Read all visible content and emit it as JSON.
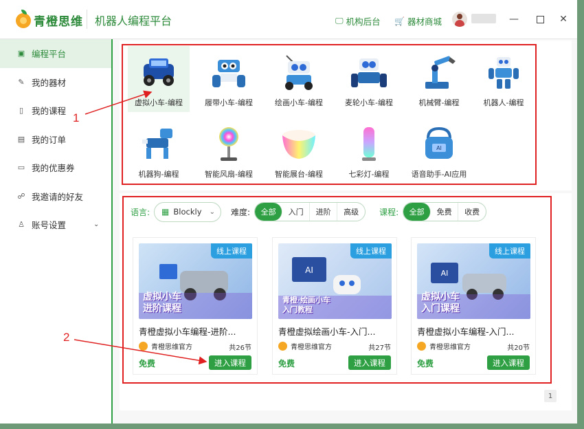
{
  "header": {
    "brand": "青橙思维",
    "title": "机器人编程平台",
    "links": [
      {
        "label": "机构后台",
        "icon": "monitor-icon"
      },
      {
        "label": "器材商城",
        "icon": "cart-icon"
      }
    ],
    "window_controls": [
      "minimize",
      "maximize",
      "close"
    ]
  },
  "sidebar": {
    "items": [
      {
        "label": "编程平台",
        "icon": "code-window-icon",
        "active": true
      },
      {
        "label": "我的器材",
        "icon": "puzzle-icon"
      },
      {
        "label": "我的课程",
        "icon": "book-icon"
      },
      {
        "label": "我的订单",
        "icon": "order-icon"
      },
      {
        "label": "我的优惠券",
        "icon": "coupon-icon"
      },
      {
        "label": "我邀请的好友",
        "icon": "friends-icon"
      },
      {
        "label": "账号设置",
        "icon": "account-icon",
        "expandable": true
      }
    ]
  },
  "programs": [
    {
      "label": "虚拟小车-编程",
      "icon": "virtual-car-icon",
      "selected": true
    },
    {
      "label": "履带小车-编程",
      "icon": "track-robot-icon"
    },
    {
      "label": "绘画小车-编程",
      "icon": "drawing-robot-icon"
    },
    {
      "label": "麦轮小车-编程",
      "icon": "mecanum-robot-icon"
    },
    {
      "label": "机械臂-编程",
      "icon": "robot-arm-icon"
    },
    {
      "label": "机器人-编程",
      "icon": "humanoid-robot-icon"
    },
    {
      "label": "机器狗-编程",
      "icon": "robot-dog-icon"
    },
    {
      "label": "智能风扇-编程",
      "icon": "smart-fan-icon"
    },
    {
      "label": "智能展台-编程",
      "icon": "smart-stage-icon"
    },
    {
      "label": "七彩灯-编程",
      "icon": "color-lamp-icon"
    },
    {
      "label": "语音助手-AI应用",
      "icon": "voice-assistant-icon"
    }
  ],
  "filters": {
    "language_label": "语言:",
    "language_value": "Blockly",
    "difficulty_label": "难度:",
    "difficulty_options": [
      "全部",
      "入门",
      "进阶",
      "高级"
    ],
    "course_label": "课程:",
    "course_options": [
      "全部",
      "免费",
      "收费"
    ]
  },
  "courses": [
    {
      "badge": "线上课程",
      "title": "青橙虚拟小车编程-进阶...",
      "org": "青橙思维官方",
      "lessons": "共26节",
      "price": "免费",
      "button": "进入课程",
      "thumb_text": [
        "虚拟小车",
        "进阶课程"
      ]
    },
    {
      "badge": "线上课程",
      "title": "青橙虚拟绘画小车-入门...",
      "org": "青橙思维官方",
      "lessons": "共27节",
      "price": "免费",
      "button": "进入课程",
      "thumb_text": [
        "青橙·绘画小车",
        "入门教程"
      ]
    },
    {
      "badge": "线上课程",
      "title": "青橙虚拟小车编程-入门...",
      "org": "青橙思维官方",
      "lessons": "共20节",
      "price": "免费",
      "button": "进入课程",
      "thumb_text": [
        "虚拟小车",
        "入门课程"
      ]
    }
  ],
  "pagination": {
    "current": "1"
  },
  "annotations": [
    "1",
    "2"
  ],
  "colors": {
    "accent": "#2ea043",
    "highlight": "#e02020",
    "badge": "#2b9fe0"
  }
}
